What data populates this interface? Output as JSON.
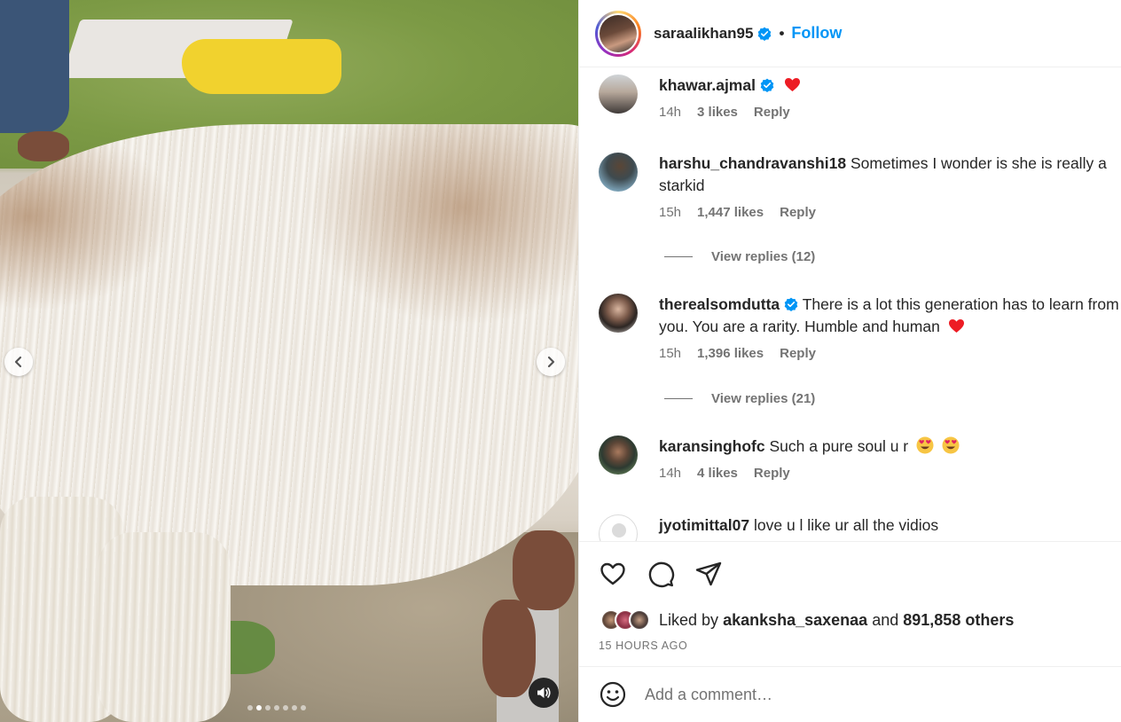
{
  "post": {
    "username": "saraalikhan95",
    "follow_label": "Follow",
    "separator": "•"
  },
  "media": {
    "carousel_total": 7,
    "carousel_active_index": 1
  },
  "comments": [
    {
      "username": "khawar.ajmal",
      "verified": true,
      "text": "",
      "emoji": "red-heart",
      "time": "14h",
      "likes": "3 likes",
      "reply_label": "Reply"
    },
    {
      "username": "harshu_chandravanshi18",
      "verified": false,
      "text": "Sometimes I wonder is she is really a starkid",
      "time": "15h",
      "likes": "1,447 likes",
      "reply_label": "Reply",
      "view_replies": "View replies (12)"
    },
    {
      "username": "therealsomdutta",
      "verified": true,
      "text": "There is a lot this generation has to learn from you. You are a rarity. Humble and human",
      "emoji": "red-heart",
      "time": "15h",
      "likes": "1,396 likes",
      "reply_label": "Reply",
      "view_replies": "View replies (21)"
    },
    {
      "username": "karansinghofc",
      "verified": false,
      "text": "Such a pure soul u r",
      "emoji": "heart-eyes x2",
      "time": "14h",
      "likes": "4 likes",
      "reply_label": "Reply"
    },
    {
      "username": "jyotimittal07",
      "verified": false,
      "text": "love u l like ur all the vidios"
    }
  ],
  "actions": {
    "like_icon": "heart-outline-icon",
    "comment_icon": "comment-bubble-icon",
    "share_icon": "paper-plane-icon"
  },
  "likes_summary": {
    "prefix": "Liked by",
    "first_liker": "akanksha_saxenaa",
    "conjunction": "and",
    "others": "891,858 others"
  },
  "timestamp": "15 HOURS AGO",
  "add_comment": {
    "placeholder": "Add a comment…",
    "emoji_icon": "smiley-icon"
  },
  "colors": {
    "accent_blue": "#0095f6",
    "text_primary": "#262626",
    "text_secondary": "#737373",
    "heart_red": "#ed1c24",
    "border": "#efefef"
  }
}
